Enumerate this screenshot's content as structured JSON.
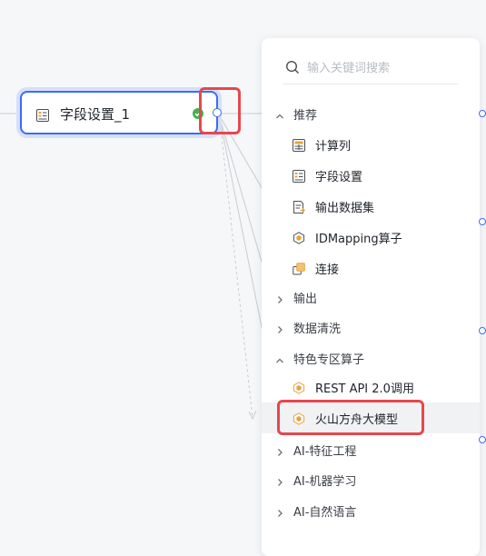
{
  "node": {
    "title": "字段设置_1",
    "icon": "field-settings-icon",
    "status_icon": "check-circle-icon",
    "accent": "#3b6cf6",
    "status_color": "#3fb34f"
  },
  "panel": {
    "search_placeholder": "输入关键词搜索",
    "groups": [
      {
        "label": "推荐",
        "expanded": true,
        "items": [
          {
            "label": "计算列",
            "icon": "calc-column-icon"
          },
          {
            "label": "字段设置",
            "icon": "field-settings-icon"
          },
          {
            "label": "输出数据集",
            "icon": "output-dataset-icon"
          },
          {
            "label": "IDMapping算子",
            "icon": "hex-operator-icon"
          },
          {
            "label": "连接",
            "icon": "join-icon"
          }
        ]
      },
      {
        "label": "输出",
        "expanded": false,
        "items": []
      },
      {
        "label": "数据清洗",
        "expanded": false,
        "items": []
      },
      {
        "label": "特色专区算子",
        "expanded": true,
        "items": [
          {
            "label": "REST API 2.0调用",
            "icon": "hex-operator-icon"
          },
          {
            "label": "火山方舟大模型",
            "icon": "hex-operator-icon",
            "highlighted": true
          }
        ]
      },
      {
        "label": "AI-特征工程",
        "expanded": false,
        "items": []
      },
      {
        "label": "AI-机器学习",
        "expanded": false,
        "items": []
      },
      {
        "label": "AI-自然语言",
        "expanded": false,
        "items": []
      }
    ]
  },
  "highlight_color": "#e5484d"
}
